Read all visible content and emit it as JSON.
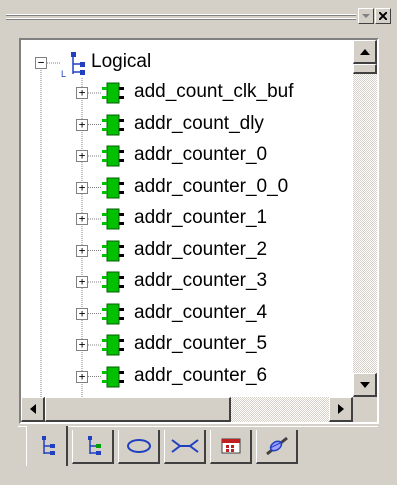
{
  "titlebar": {
    "dropdown_icon": "chevron-down-icon",
    "close_icon": "close-icon"
  },
  "tree": {
    "root_label": "Logical",
    "root_expander": "−",
    "items": [
      {
        "label": "add_count_clk_buf",
        "expander": "+"
      },
      {
        "label": "addr_count_dly",
        "expander": "+"
      },
      {
        "label": "addr_counter_0",
        "expander": "+"
      },
      {
        "label": "addr_counter_0_0",
        "expander": "+"
      },
      {
        "label": "addr_counter_1",
        "expander": "+"
      },
      {
        "label": "addr_counter_2",
        "expander": "+"
      },
      {
        "label": "addr_counter_3",
        "expander": "+"
      },
      {
        "label": "addr_counter_4",
        "expander": "+"
      },
      {
        "label": "addr_counter_5",
        "expander": "+"
      },
      {
        "label": "addr_counter_6",
        "expander": "+"
      }
    ]
  },
  "tabs": [
    {
      "name": "logical-hierarchy-icon",
      "active": true
    },
    {
      "name": "physical-hierarchy-icon",
      "active": false
    },
    {
      "name": "ellipse-icon",
      "active": false
    },
    {
      "name": "net-connector-icon",
      "active": false
    },
    {
      "name": "calendar-grid-icon",
      "active": false
    },
    {
      "name": "probe-tool-icon",
      "active": false
    }
  ],
  "colors": {
    "chrome": "#d4d0c8",
    "component_green": "#00c000",
    "hier_blue": "#2040c0"
  }
}
